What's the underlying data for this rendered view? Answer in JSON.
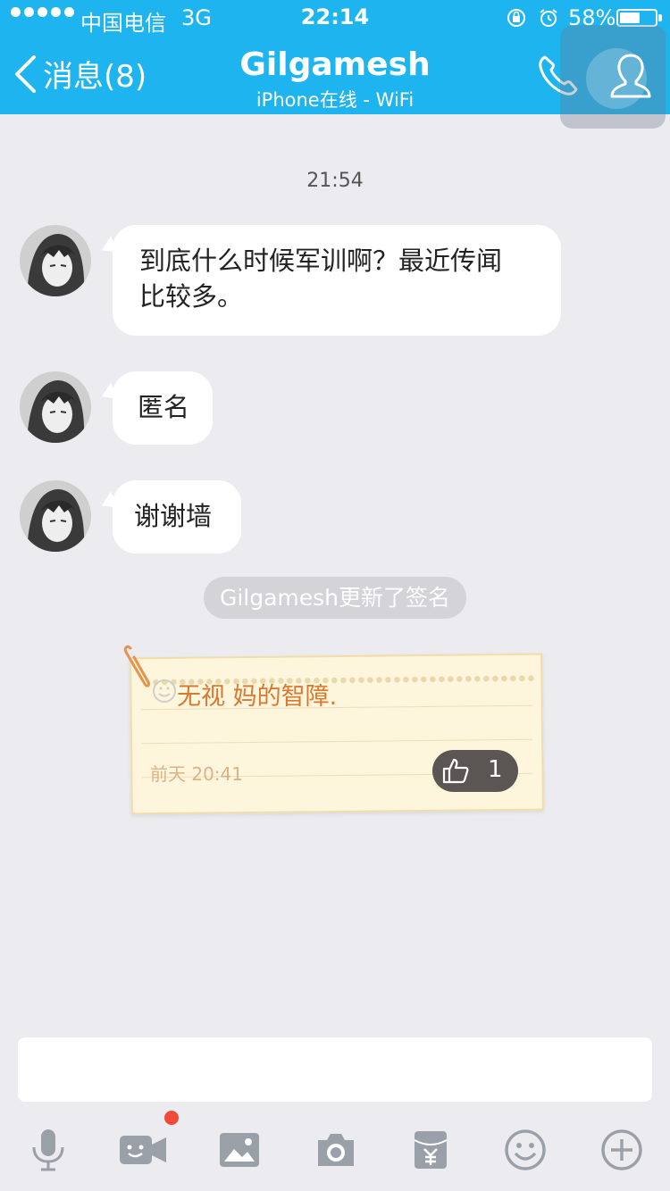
{
  "status_bar": {
    "carrier": "中国电信",
    "network": "3G",
    "time": "22:14",
    "battery": "58%",
    "battery_level": 0.58
  },
  "nav": {
    "back_label": "消息(8)",
    "title": "Gilgamesh",
    "subtitle": "iPhone在线 - WiFi"
  },
  "chat": {
    "timestamp": "21:54",
    "messages": [
      {
        "text_line1": "到底什么时候军训啊？最近传闻",
        "text_line2": "比较多。"
      },
      {
        "text": "匿名"
      },
      {
        "text": "谢谢墙"
      }
    ],
    "system_notice": "Gilgamesh更新了签名",
    "signature_card": {
      "text": "无视 妈的智障.",
      "time": "前天 20:41",
      "likes": "1"
    }
  },
  "input": {
    "placeholder": ""
  },
  "toolbar": [
    "mic-icon",
    "video-icon",
    "image-icon",
    "camera-icon",
    "red-packet-icon",
    "emoji-icon",
    "plus-icon"
  ],
  "colors": {
    "header": "#1eb4f0",
    "background": "#ebebf0",
    "note_text": "#d9782f",
    "badge": "#f04a3a"
  }
}
